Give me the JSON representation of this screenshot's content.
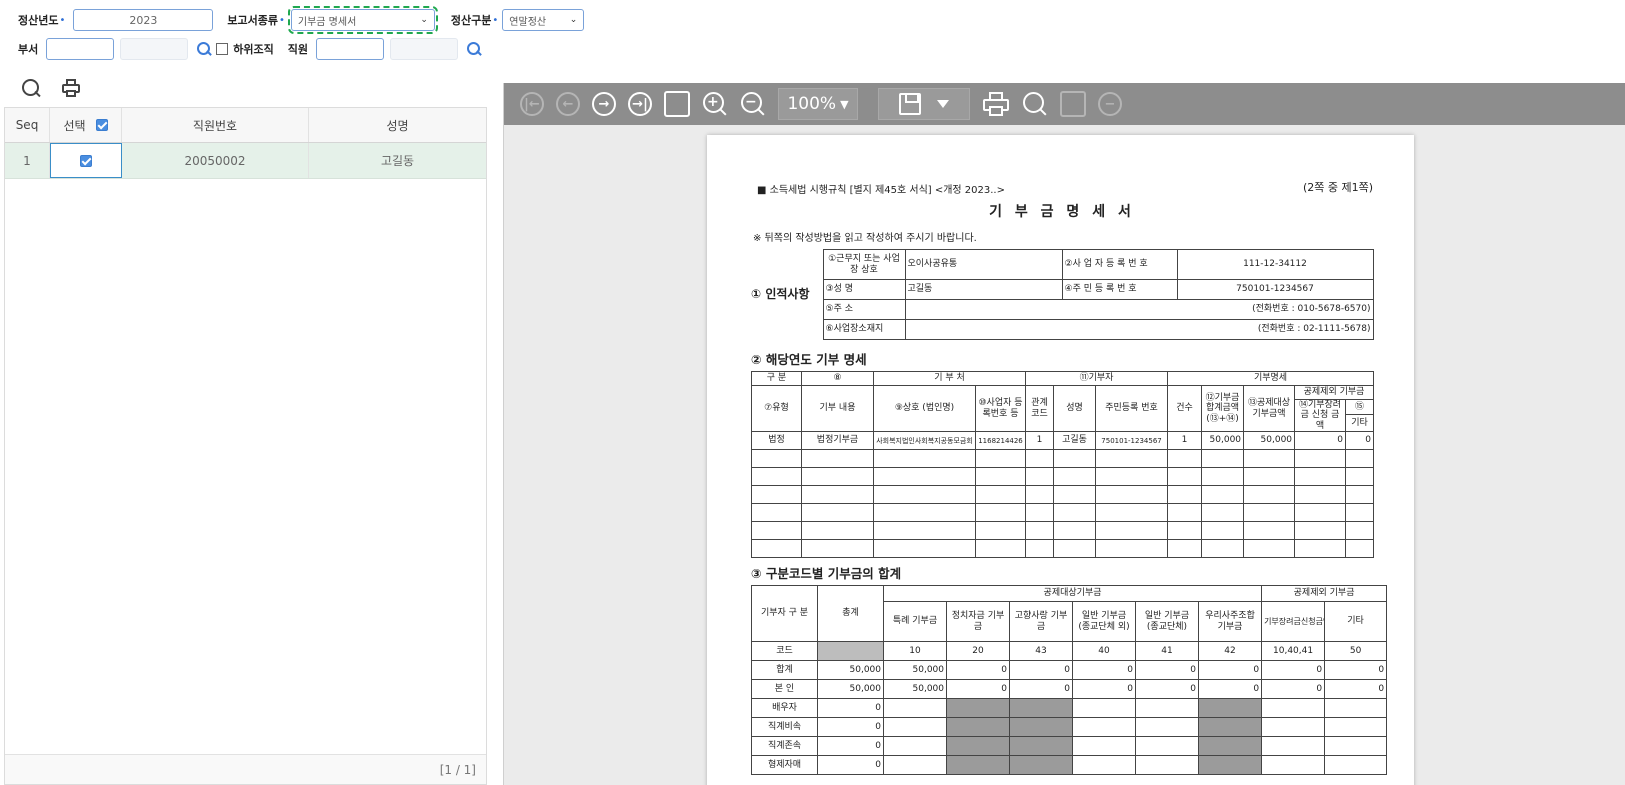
{
  "filters": {
    "settle_year_label": "정산년도",
    "settle_year_value": "2023",
    "report_type_label": "보고서종류",
    "report_type_value": "기부금 명세서",
    "settle_kind_label": "정산구분",
    "settle_kind_value": "연말정산",
    "dept_label": "부서",
    "sub_org_label": "하위조직",
    "employee_label": "직원"
  },
  "grid": {
    "columns": [
      "Seq",
      "선택",
      "직원번호",
      "성명"
    ],
    "rows": [
      {
        "seq": "1",
        "emp_no": "20050002",
        "name": "고길동"
      }
    ],
    "pager": "[1 / 1]"
  },
  "viewer": {
    "zoom": "100%"
  },
  "doc": {
    "form_id": "■ 소득세법 시행규칙 [별지 제45호 서식] <개정 2023..>",
    "page_no": "(2쪽 중 제1쪽)",
    "title": "기 부 금 명 세 서",
    "notice": "※ 뒤쪽의 작성방법을 읽고 작성하여 주시기 바랍니다.",
    "s1": {
      "heading": "① 인적사항",
      "biz_name_label": "①근무지 또는 사업장 상호",
      "biz_name": "오이사공유통",
      "biz_reg_label": "②사 업 자 등 록 번 호",
      "biz_reg": "111-12-34112",
      "person_label": "③성 명",
      "person": "고길동",
      "rrn_label": "④주 민 등 록 번 호",
      "rrn": "750101-1234567",
      "addr_label": "⑤주 소",
      "addr_phone": "(전화번호 : 010-5678-6570)",
      "biz_addr_label": "⑥사업장소재지",
      "biz_phone": "(전화번호 : 02-1111-5678)"
    },
    "s2": {
      "heading": "② 해당연도 기부 명세",
      "h_gubun": "구 분",
      "h_type": "⑦유형",
      "h_content_num": "⑧",
      "h_content": "기부 내용",
      "h_donee": "기 부 처",
      "h_donee_name": "⑨상호 (법인명)",
      "h_donee_reg": "⑩사업자 등록번호 등",
      "h_donor": "⑪기부자",
      "h_relation": "관계 코드",
      "h_donor_name": "성명",
      "h_donor_rrn": "주민등록 번호",
      "h_detail": "기부명세",
      "h_count": "건수",
      "h_total": "⑫기부금 합계금액 (⑬+⑭)",
      "h_deduct_amt": "⑬공제대상 기부금액",
      "h_excluded": "공제제외 기부금",
      "h_credit_req": "⑭기부장려금 신청 금액",
      "h_other_num": "⑮",
      "h_other": "기타",
      "row": {
        "type": "법정",
        "content": "법정기부금",
        "donee_name": "사회복지법인사회복지공동모금회",
        "donee_reg": "1168214426",
        "relation": "1",
        "donor_name": "고길동",
        "donor_rrn": "750101-1234567",
        "count": "1",
        "total": "50,000",
        "deduct": "50,000",
        "credit": "0",
        "other": "0"
      }
    },
    "s3": {
      "heading": "③ 구분코드별 기부금의 합계",
      "h_donor_gubun": "기부자 구 분",
      "h_total": "총계",
      "h_deductible": "공제대상기부금",
      "h_excluded": "공제제외 기부금",
      "cols": [
        "특례 기부금",
        "정치자금 기부금",
        "고향사랑 기부금",
        "일반 기부금 (종교단체 외)",
        "일반 기부금 (종교단체)",
        "우리사주조합 기부금",
        "기부장려금신청금액",
        "기타"
      ],
      "code_label": "코드",
      "codes": [
        "10",
        "20",
        "43",
        "40",
        "41",
        "42",
        "10,40,41",
        "50"
      ],
      "rows": [
        {
          "label": "합계",
          "total": "50,000",
          "vals": [
            "50,000",
            "0",
            "0",
            "0",
            "0",
            "0",
            "0",
            "0"
          ]
        },
        {
          "label": "본 인",
          "total": "50,000",
          "vals": [
            "50,000",
            "0",
            "0",
            "0",
            "0",
            "0",
            "0",
            "0"
          ]
        },
        {
          "label": "배우자",
          "total": "0",
          "vals": []
        },
        {
          "label": "직계비속",
          "total": "0",
          "vals": []
        },
        {
          "label": "직계존속",
          "total": "0",
          "vals": []
        },
        {
          "label": "형제자매",
          "total": "0",
          "vals": []
        }
      ]
    }
  }
}
